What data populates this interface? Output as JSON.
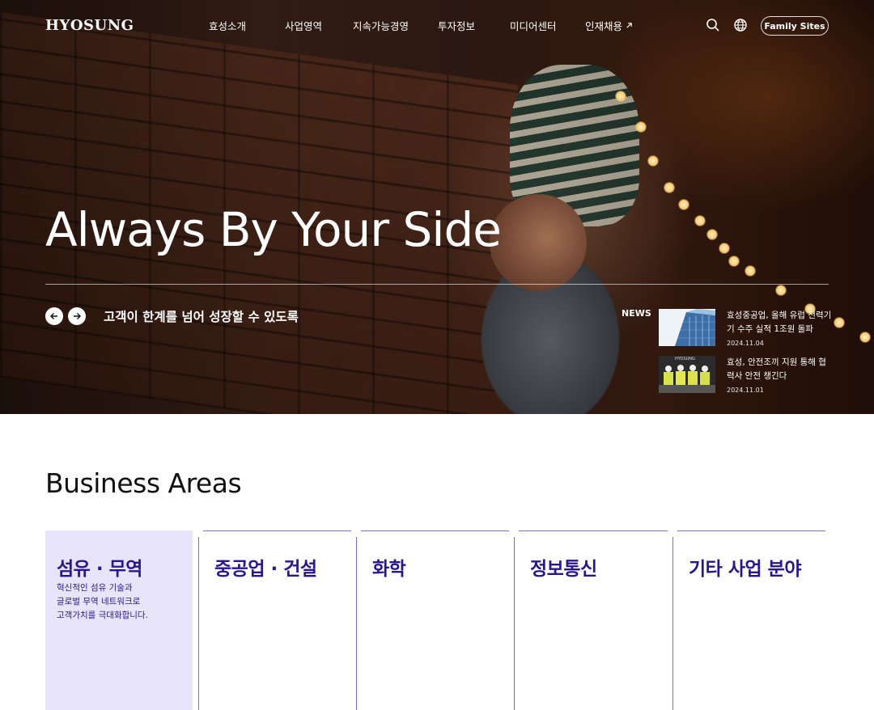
{
  "header": {
    "logo": "HYOSUNG",
    "menu": [
      {
        "label": "효성소개"
      },
      {
        "label": "사업영역"
      },
      {
        "label": "지속가능경영"
      },
      {
        "label": "투자정보"
      },
      {
        "label": "미디어센터"
      },
      {
        "label": "인재채용",
        "icon": "external-arrow-icon"
      }
    ],
    "search_icon": "search-icon",
    "language_icon": "globe-icon",
    "family_sites": "Family Sites"
  },
  "hero": {
    "headline": "Always By Your Side",
    "subline": "고객이 한계를 넘어 성장할 수 있도록",
    "prev_icon": "arrow-left-icon",
    "next_icon": "arrow-right-icon"
  },
  "news": {
    "label": "NEWS",
    "items": [
      {
        "title": "효성중공업, 올해 유럽 전력기기 수주 실적 1조원 돌파",
        "date": "2024.11.04"
      },
      {
        "title": "효성, 안전조끼 지원 통해 협력사 안전 챙긴다",
        "date": "2024.11.01",
        "thumb_text": "HYOSUNG"
      }
    ]
  },
  "business": {
    "title": "Business Areas",
    "cards": [
      {
        "title": "섬유 · 무역",
        "desc": [
          "혁신적인 섬유 기술과",
          "글로벌 무역 네트워크로",
          "고객가치를 극대화합니다."
        ],
        "active": true
      },
      {
        "title": "중공업 · 건설"
      },
      {
        "title": "화학"
      },
      {
        "title": "정보통신"
      },
      {
        "title": "기타 사업 분야"
      }
    ]
  },
  "colors": {
    "accent": "#2a1590",
    "card_active_bg": "#e8e5fb",
    "line": "#7b6fd6"
  }
}
